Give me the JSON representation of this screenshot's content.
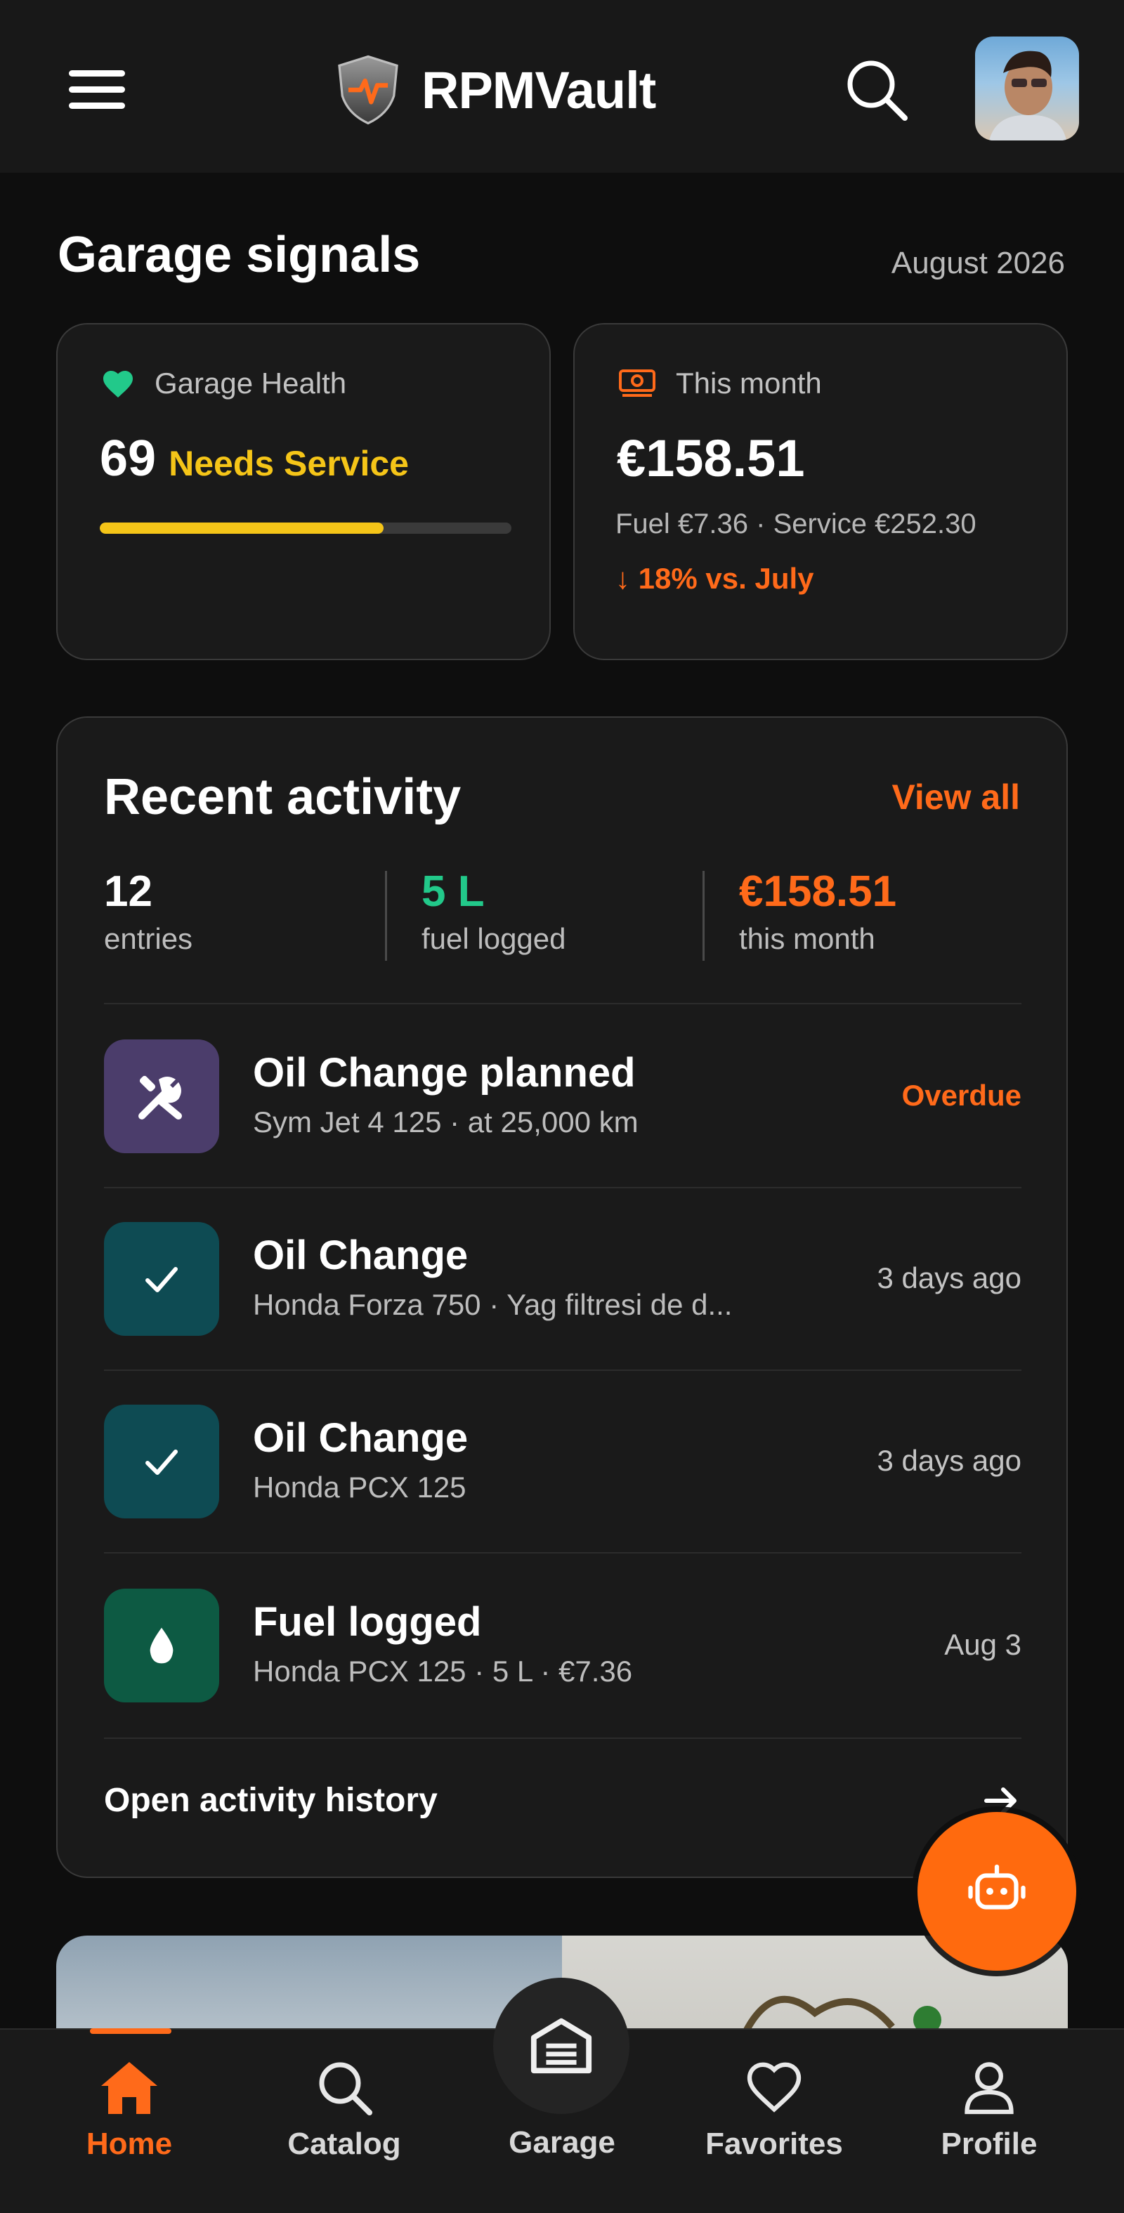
{
  "header": {
    "app_name": "RPMVault",
    "menu_icon": "hamburger-menu-icon",
    "search_icon": "search-icon",
    "avatar": "user-avatar"
  },
  "signals": {
    "title": "Garage signals",
    "date": "August 2026",
    "health": {
      "label": "Garage Health",
      "score": "69",
      "status": "Needs Service",
      "progress_fraction": 0.69,
      "icon": "heart-icon",
      "icon_color": "#22c98a",
      "status_color": "#f5c518"
    },
    "month": {
      "label": "This month",
      "amount": "€158.51",
      "breakdown": "Fuel €7.36 · Service €252.30",
      "change": "↓ 18% vs. July",
      "icon": "money-icon",
      "accent": "#ff6a1a"
    }
  },
  "activity": {
    "title": "Recent activity",
    "view_all": "View all",
    "stats": [
      {
        "value": "12",
        "label": "entries",
        "color": "#ffffff"
      },
      {
        "value": "5 L",
        "label": "fuel logged",
        "color": "#22c98a"
      },
      {
        "value": "€158.51",
        "label": "this month",
        "color": "#ff6a1a"
      }
    ],
    "items": [
      {
        "title": "Oil Change planned",
        "subtitle": "Sym Jet 4 125 · at 25,000 km",
        "meta": "Overdue",
        "icon": "tools-icon",
        "icon_bg": "#4b3d6b"
      },
      {
        "title": "Oil Change",
        "subtitle": "Honda Forza 750 · Yag filtresi de d...",
        "meta": "3 days ago",
        "icon": "check-icon",
        "icon_bg": "#0e4b53"
      },
      {
        "title": "Oil Change",
        "subtitle": "Honda PCX 125",
        "meta": "3 days ago",
        "icon": "check-icon",
        "icon_bg": "#0e4b53"
      },
      {
        "title": "Fuel logged",
        "subtitle": "Honda PCX 125 · 5 L · €7.36",
        "meta": "Aug 3",
        "icon": "fuel-drop-icon",
        "icon_bg": "#0d5a43"
      }
    ],
    "history_link": "Open activity history"
  },
  "fab": {
    "icon": "robot-icon",
    "color": "#ff6a0e"
  },
  "nav": {
    "items": [
      {
        "label": "Home",
        "icon": "home-icon",
        "active": true
      },
      {
        "label": "Catalog",
        "icon": "search-icon"
      },
      {
        "label": "Garage",
        "icon": "garage-icon"
      },
      {
        "label": "Favorites",
        "icon": "heart-outline-icon"
      },
      {
        "label": "Profile",
        "icon": "user-icon"
      }
    ]
  }
}
